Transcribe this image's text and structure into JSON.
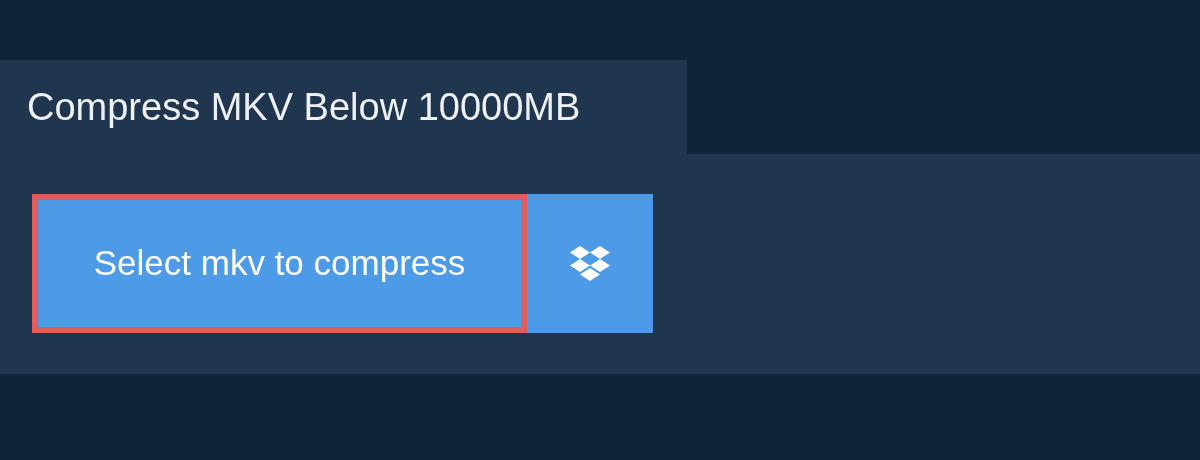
{
  "tab": {
    "title": "Compress MKV Below 10000MB"
  },
  "select_button": {
    "label": "Select mkv to compress",
    "focused": true
  }
}
